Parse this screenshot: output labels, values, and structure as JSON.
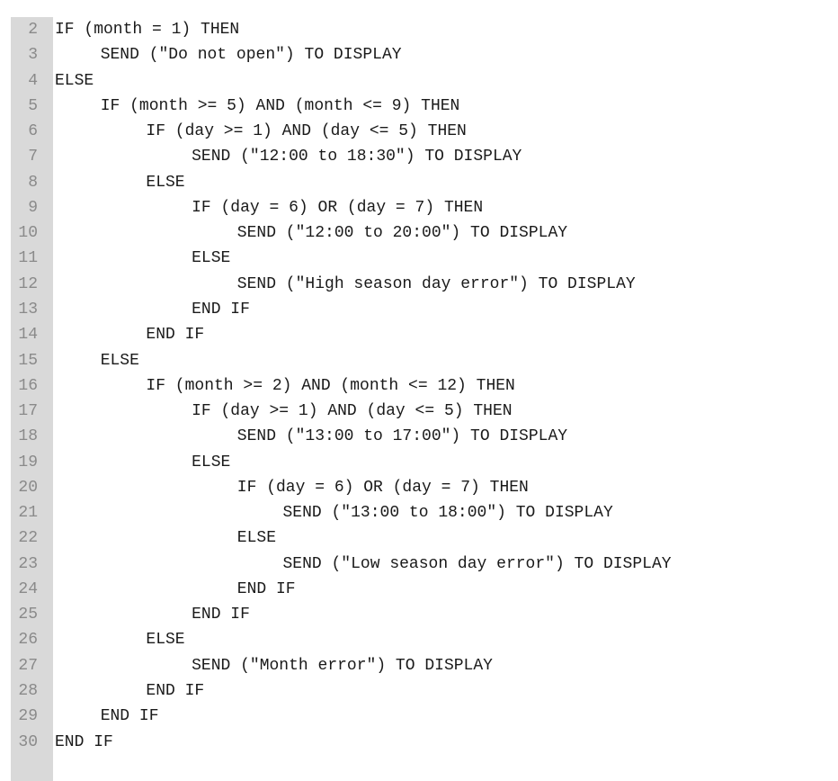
{
  "code": {
    "lines": [
      {
        "number": "2",
        "indent": 0,
        "text": "IF (month = 1) THEN"
      },
      {
        "number": "3",
        "indent": 1,
        "text": "SEND (\"Do not open\") TO DISPLAY"
      },
      {
        "number": "4",
        "indent": 0,
        "text": "ELSE"
      },
      {
        "number": "5",
        "indent": 1,
        "text": "IF (month >= 5) AND (month <= 9) THEN"
      },
      {
        "number": "6",
        "indent": 2,
        "text": "IF (day >= 1) AND (day <= 5) THEN"
      },
      {
        "number": "7",
        "indent": 3,
        "text": "SEND (\"12:00 to 18:30\") TO DISPLAY"
      },
      {
        "number": "8",
        "indent": 2,
        "text": "ELSE"
      },
      {
        "number": "9",
        "indent": 3,
        "text": "IF (day = 6) OR (day = 7) THEN"
      },
      {
        "number": "10",
        "indent": 4,
        "text": "SEND (\"12:00 to 20:00\") TO DISPLAY"
      },
      {
        "number": "11",
        "indent": 3,
        "text": "ELSE"
      },
      {
        "number": "12",
        "indent": 4,
        "text": "SEND (\"High season day error\") TO DISPLAY"
      },
      {
        "number": "13",
        "indent": 3,
        "text": "END IF"
      },
      {
        "number": "14",
        "indent": 2,
        "text": "END IF"
      },
      {
        "number": "15",
        "indent": 1,
        "text": "ELSE"
      },
      {
        "number": "16",
        "indent": 2,
        "text": "IF (month >= 2) AND (month <= 12) THEN"
      },
      {
        "number": "17",
        "indent": 3,
        "text": "IF (day >= 1) AND (day <= 5) THEN"
      },
      {
        "number": "18",
        "indent": 4,
        "text": "SEND (\"13:00 to 17:00\") TO DISPLAY"
      },
      {
        "number": "19",
        "indent": 3,
        "text": "ELSE"
      },
      {
        "number": "20",
        "indent": 4,
        "text": "IF (day = 6) OR (day = 7) THEN"
      },
      {
        "number": "21",
        "indent": 5,
        "text": "SEND (\"13:00 to 18:00\") TO DISPLAY"
      },
      {
        "number": "22",
        "indent": 4,
        "text": "ELSE"
      },
      {
        "number": "23",
        "indent": 5,
        "text": "SEND (\"Low season day error\") TO DISPLAY"
      },
      {
        "number": "24",
        "indent": 4,
        "text": "END IF"
      },
      {
        "number": "25",
        "indent": 3,
        "text": "END IF"
      },
      {
        "number": "26",
        "indent": 2,
        "text": "ELSE"
      },
      {
        "number": "27",
        "indent": 3,
        "text": "SEND (\"Month error\") TO DISPLAY"
      },
      {
        "number": "28",
        "indent": 2,
        "text": "END IF"
      },
      {
        "number": "29",
        "indent": 1,
        "text": "END IF"
      },
      {
        "number": "30",
        "indent": 0,
        "text": "END IF"
      }
    ]
  }
}
